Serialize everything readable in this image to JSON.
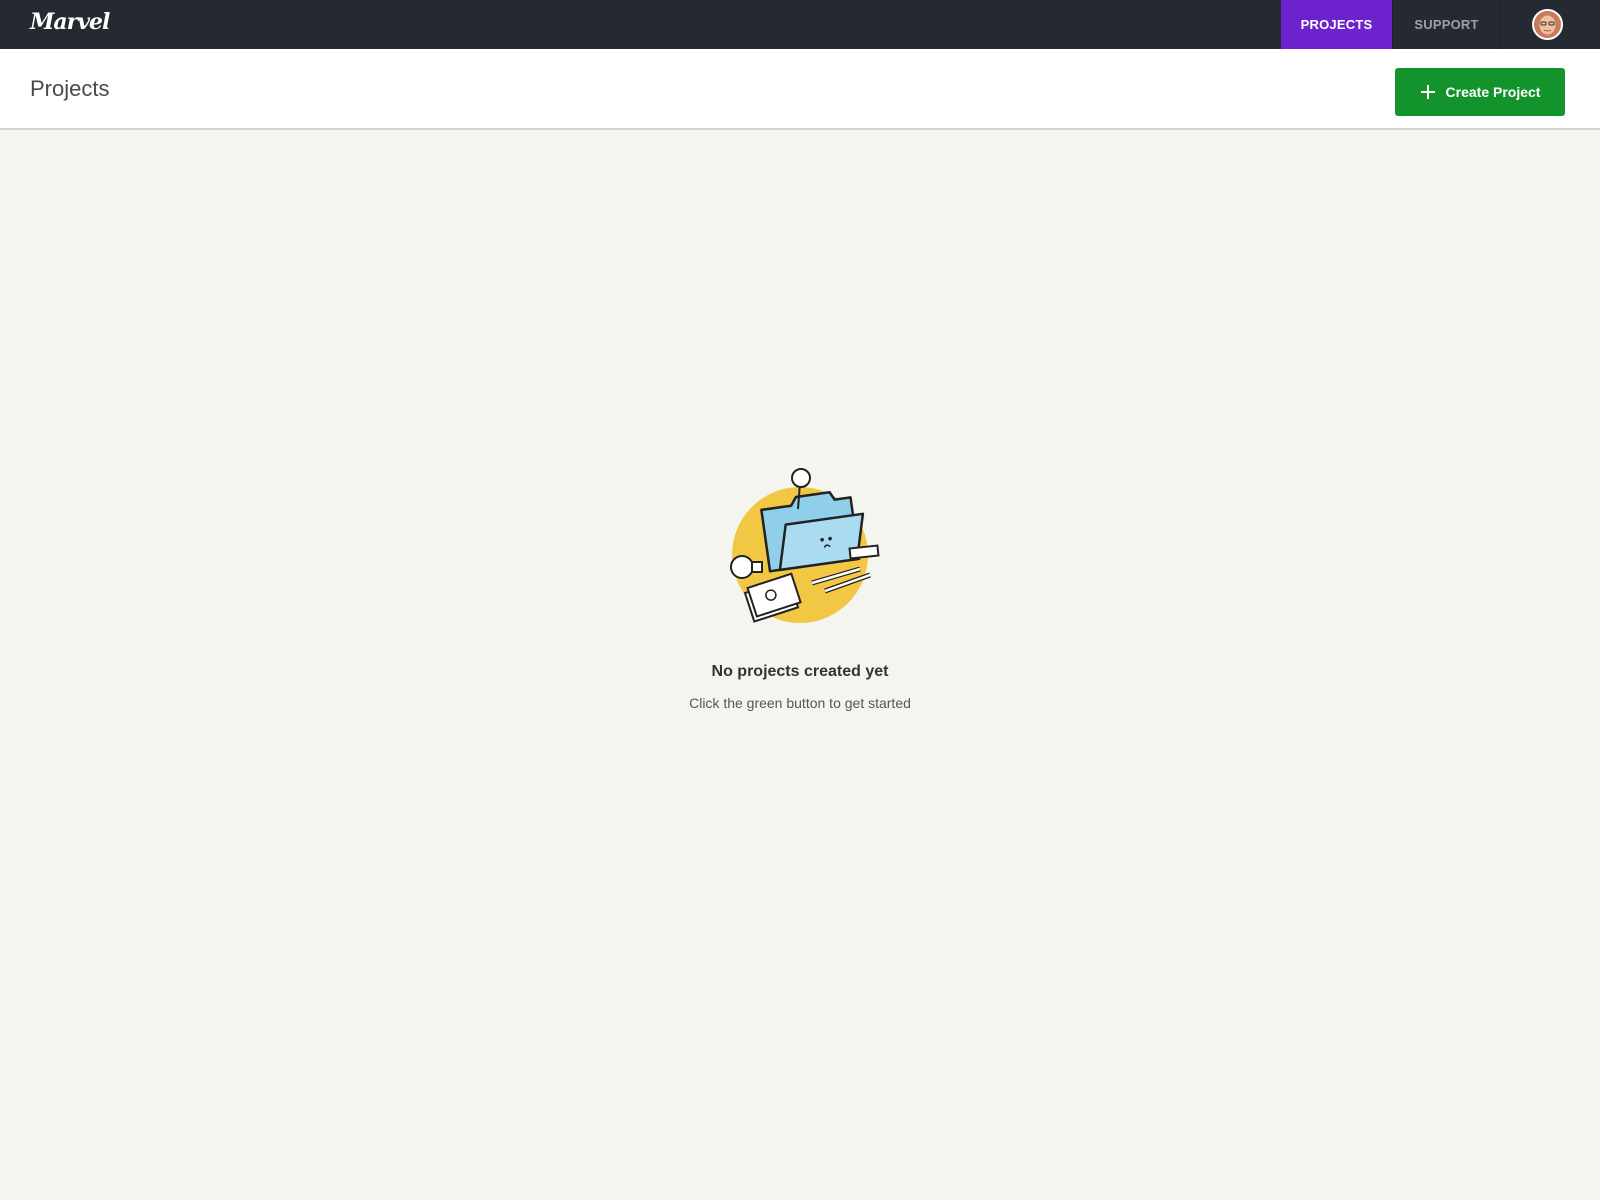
{
  "app": {
    "logo": "Marvel"
  },
  "nav": {
    "projects_label": "PROJECTS",
    "support_label": "SUPPORT",
    "active": "PROJECTS",
    "active_color": "#6c22cc"
  },
  "header": {
    "title": "Projects",
    "create_button_label": "Create Project",
    "create_button_color": "#12932c"
  },
  "empty_state": {
    "title": "No projects created yet",
    "subtitle": "Click the green button to get started"
  },
  "icons": [
    "plus-icon",
    "avatar",
    "empty-folder-illustration"
  ]
}
